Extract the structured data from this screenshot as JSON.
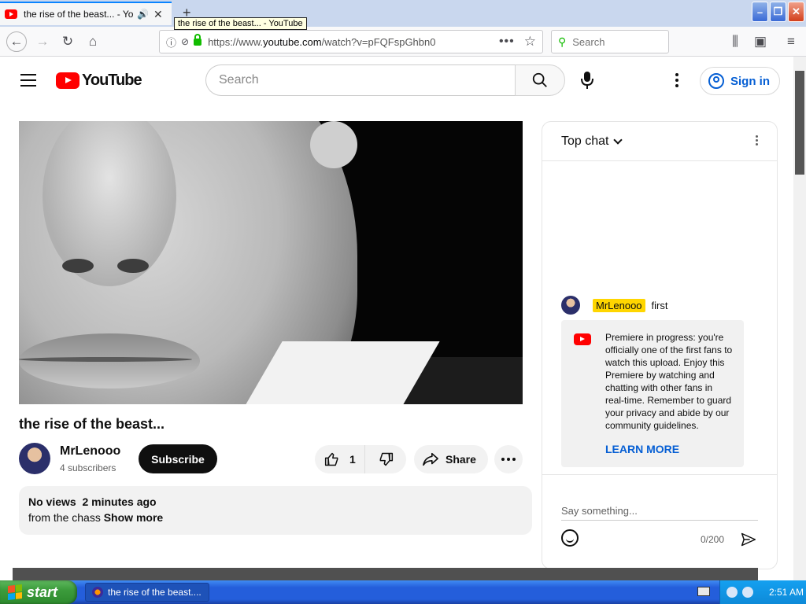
{
  "browser": {
    "tab_title": "the rise of the beast... - YouTube",
    "tooltip": "the rise of the beast... - YouTube",
    "url_prefix": "https://www.",
    "url_domain": "youtube.com",
    "url_path": "/watch?v=pFQFspGhbn0",
    "search_placeholder": "Search",
    "new_tab_label": "+"
  },
  "youtube": {
    "logo_text": "YouTube",
    "search_placeholder": "Search",
    "signin_label": "Sign in"
  },
  "video": {
    "title": "the rise of the beast...",
    "channel_name": "MrLenooo",
    "subscribers": "4 subscribers",
    "subscribe_label": "Subscribe",
    "like_count": "1",
    "share_label": "Share",
    "stats": "No views  2 minutes ago",
    "description": "from the chass",
    "show_more": "Show more"
  },
  "chat": {
    "header": "Top chat",
    "message_author": "MrLenooo",
    "message_text": "first",
    "notice_text": "Premiere in progress: you're officially one of the first fans to watch this upload. Enjoy this Premiere by watching and chatting with other fans in real-time. Remember to guard your privacy and abide by our community guidelines.",
    "learn_more": "LEARN MORE",
    "input_placeholder": "Say something...",
    "char_count": "0/200"
  },
  "taskbar": {
    "start_label": "start",
    "task_title": "the rise of the beast....",
    "clock": "2:51 AM"
  },
  "colors": {
    "youtube_red": "#ff0000",
    "link_blue": "#065fd4",
    "author_highlight": "#ffd600",
    "taskbar_blue": "#245edb",
    "start_green": "#3c9c3c"
  },
  "icons": [
    "youtube-favicon",
    "speaker-icon",
    "close-icon",
    "back-icon",
    "forward-icon",
    "reload-icon",
    "home-icon",
    "info-icon",
    "lock-icon",
    "page-actions-icon",
    "bookmark-star-icon",
    "library-icon",
    "sidebar-icon",
    "menu-icon",
    "hamburger-icon",
    "search-icon",
    "mic-icon",
    "more-vert-icon",
    "account-icon",
    "like-icon",
    "dislike-icon",
    "share-icon",
    "chevron-down-icon",
    "emoji-icon",
    "send-icon",
    "windows-flag-icon"
  ]
}
